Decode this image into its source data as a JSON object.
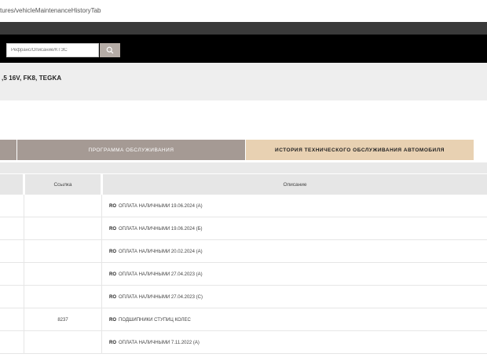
{
  "browser": {
    "url": "tures/vehicleMaintenanceHistoryTab"
  },
  "search": {
    "placeholder": "Рефранс/Описание/КТЭС"
  },
  "vehicle": {
    "title": ",5 16V, FK8, TEGKA"
  },
  "tabs": [
    {
      "label": ""
    },
    {
      "label": "ПРОГРАММА ОБСЛУЖИВАНИЯ"
    },
    {
      "label": "ИСТОРИЯ ТЕХНИЧЕСКОГО ОБСЛУЖИВАНИЯ АВТОМОБИЛЯ",
      "active": true
    }
  ],
  "table": {
    "headers": [
      "",
      "Ссылка",
      "Описание"
    ],
    "rows": [
      {
        "code": "",
        "badge": "RO",
        "text": "ОПЛАТА НАЛИЧНЫМИ 19.06.2024 (А)"
      },
      {
        "code": "",
        "badge": "RO",
        "text": "ОПЛАТА НАЛИЧНЫМИ 19.06.2024 (Б)"
      },
      {
        "code": "",
        "badge": "RO",
        "text": "ОПЛАТА НАЛИЧНЫМИ 20.02.2024 (А)"
      },
      {
        "code": "",
        "badge": "RO",
        "text": "ОПЛАТА НАЛИЧНЫМИ 27.04.2023 (А)"
      },
      {
        "code": "",
        "badge": "RO",
        "text": "ОПЛАТА НАЛИЧНЫМИ 27.04.2023 (С)"
      },
      {
        "code": "8237",
        "badge": "RO",
        "text": "ПОДШИПНИКИ СТУПИЦ КОЛЕС"
      },
      {
        "code": "",
        "badge": "RO",
        "text": "ОПЛАТА НАЛИЧНЫМИ 7.11.2022 (А)"
      }
    ]
  },
  "colors": {
    "navbar": "#000000",
    "tab_inactive": "#a59a94",
    "tab_active": "#e8d1b2",
    "search_button": "#b5aca6"
  },
  "icons": {
    "search_button": "search-icon"
  }
}
